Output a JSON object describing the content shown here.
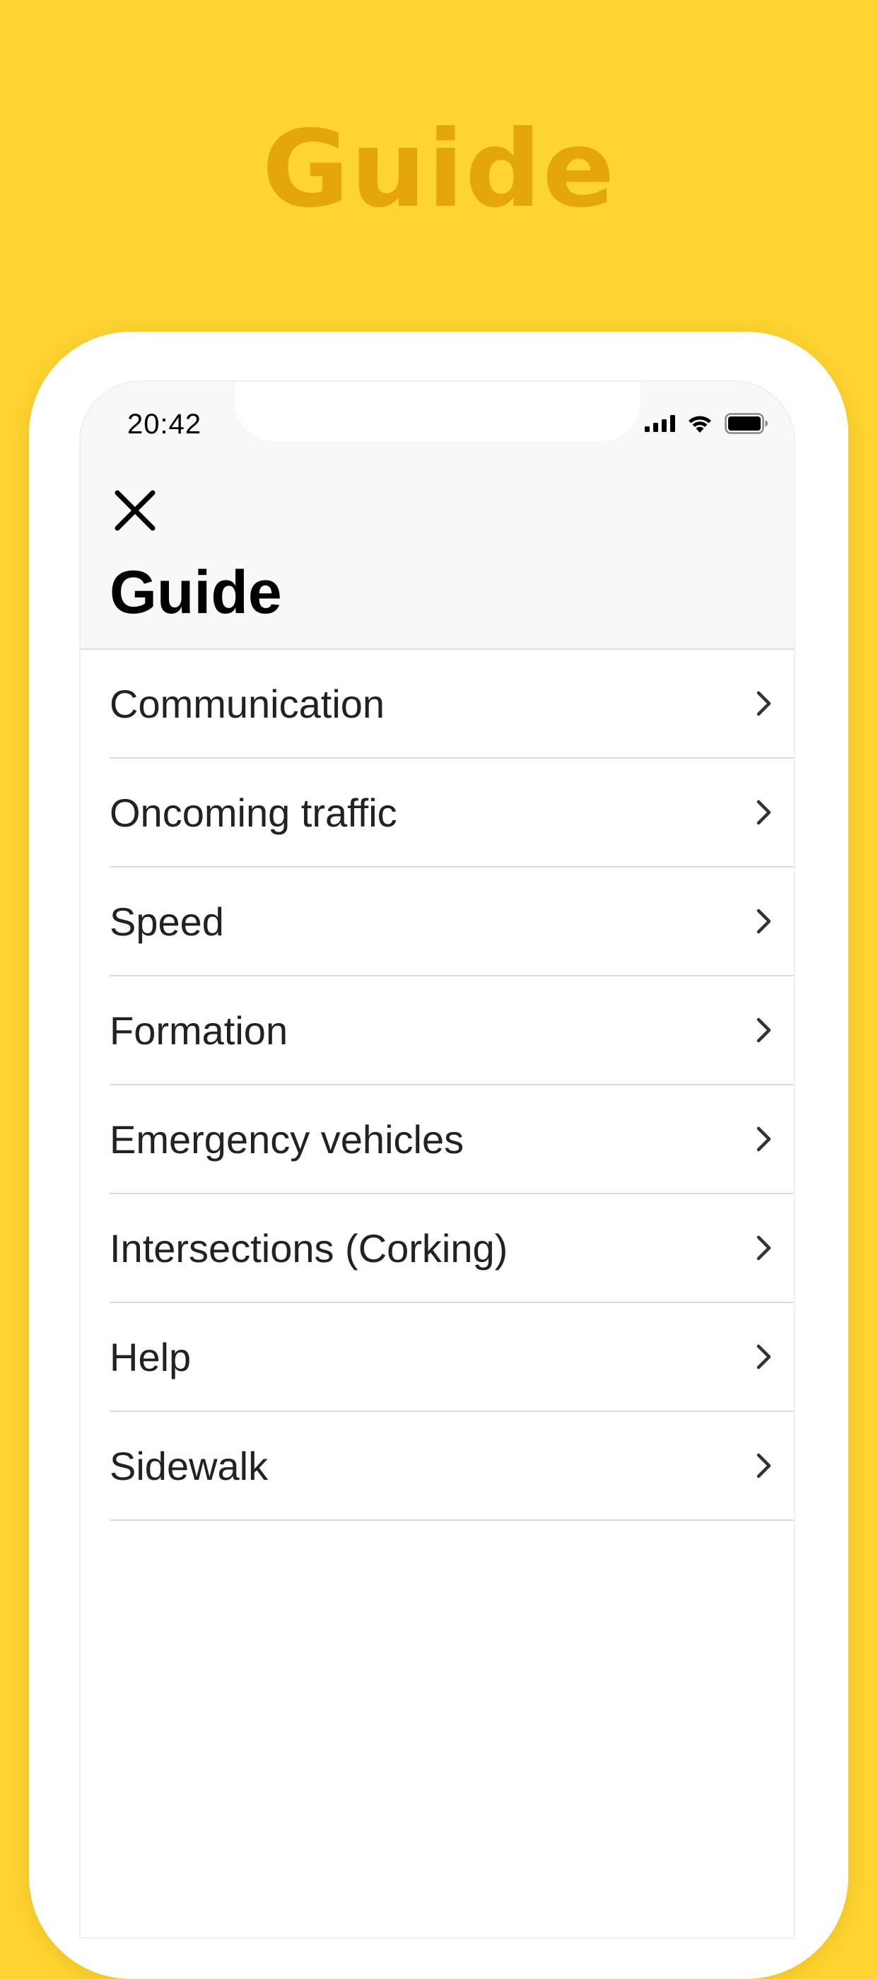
{
  "banner": {
    "title": "Guide"
  },
  "status_bar": {
    "time": "20:42"
  },
  "header": {
    "title": "Guide",
    "close_icon": "close-icon"
  },
  "guide_items": [
    {
      "label": "Communication"
    },
    {
      "label": "Oncoming traffic"
    },
    {
      "label": "Speed"
    },
    {
      "label": "Formation"
    },
    {
      "label": "Emergency vehicles"
    },
    {
      "label": "Intersections (Corking)"
    },
    {
      "label": "Help"
    },
    {
      "label": "Sidewalk"
    }
  ],
  "colors": {
    "background": "#FED430",
    "banner_text": "#E5A50C",
    "header_background": "#F8F8F8",
    "text": "#222222"
  }
}
